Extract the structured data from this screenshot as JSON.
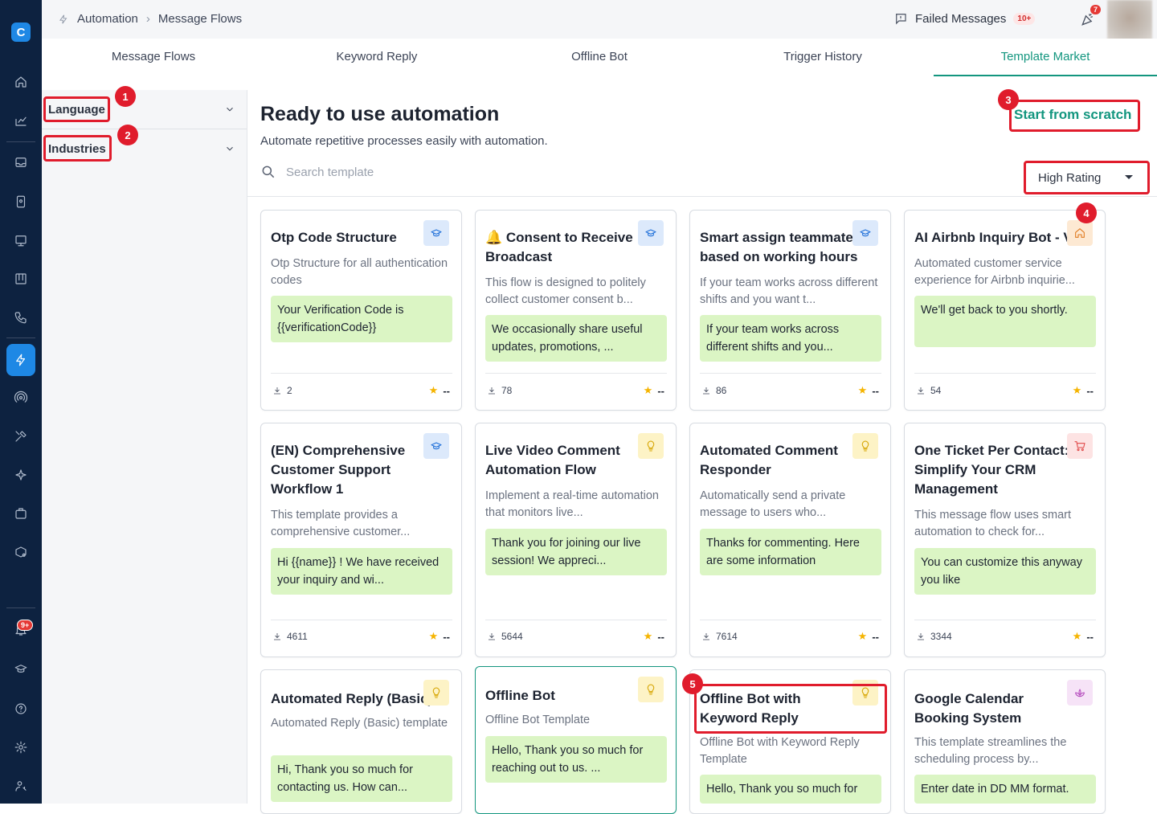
{
  "breadcrumb": {
    "section": "Automation",
    "page": "Message Flows"
  },
  "header": {
    "failed_label": "Failed Messages",
    "failed_badge": "10+",
    "notif_badge": "7"
  },
  "sidebar": {
    "logo": "C",
    "notif_badge": "9+"
  },
  "tabs": [
    "Message Flows",
    "Keyword Reply",
    "Offline Bot",
    "Trigger History",
    "Template Market"
  ],
  "active_tab": "Template Market",
  "filters": [
    {
      "label": "Language"
    },
    {
      "label": "Industries"
    }
  ],
  "main": {
    "title": "Ready to use automation",
    "subtitle": "Automate repetitive processes easily with automation.",
    "start_scratch": "Start from scratch",
    "search_placeholder": "Search template",
    "sort_value": "High Rating"
  },
  "annotations": [
    "1",
    "2",
    "3",
    "4",
    "5"
  ],
  "cards": [
    {
      "title": "Otp Code Structure",
      "desc": "Otp Structure for all authentication codes",
      "message": "Your Verification Code is {{verificationCode}}",
      "downloads": "2",
      "rating": "--",
      "icon": "graduation-cap-icon"
    },
    {
      "title": "🔔 Consent to Receive Broadcast",
      "desc": "This flow is designed to politely collect customer consent b...",
      "message": "We occasionally share useful updates, promotions, ...",
      "downloads": "78",
      "rating": "--",
      "icon": "graduation-cap-icon"
    },
    {
      "title": "Smart assign teammate based on working hours",
      "desc": "If your team works across different shifts and you want t...",
      "message": "If your team works across different shifts and you...",
      "downloads": "86",
      "rating": "--",
      "icon": "graduation-cap-icon"
    },
    {
      "title": "AI Airbnb Inquiry Bot - V",
      "desc": "Automated customer service experience for Airbnb inquirie...",
      "message": "We'll get back to you shortly.",
      "downloads": "54",
      "rating": "--",
      "icon": "home-icon"
    },
    {
      "title": "(EN) Comprehensive Customer Support Workflow 1",
      "desc": "This template provides a comprehensive customer...",
      "message": "Hi {{name}} ! We have received your inquiry and wi...",
      "downloads": "4611",
      "rating": "--",
      "icon": "graduation-cap-icon"
    },
    {
      "title": "Live Video Comment Automation Flow",
      "desc": "Implement a real-time automation that monitors live...",
      "message": "Thank you for joining our live session! We appreci...",
      "downloads": "5644",
      "rating": "--",
      "icon": "lightbulb-icon"
    },
    {
      "title": "Automated Comment Responder",
      "desc": "Automatically send a private message to users who...",
      "message": "Thanks for commenting. Here are some information",
      "downloads": "7614",
      "rating": "--",
      "icon": "lightbulb-icon"
    },
    {
      "title": "One Ticket Per Contact: Simplify Your CRM Management",
      "desc": "This message flow uses smart automation to check for...",
      "message": "You can customize this anyway you like",
      "downloads": "3344",
      "rating": "--",
      "icon": "shopping-cart-icon"
    },
    {
      "title": "Automated Reply (Basic)",
      "desc": "Automated Reply (Basic) template",
      "message": "Hi, Thank you so much for contacting us. How can...",
      "icon": "lightbulb-icon"
    },
    {
      "title": "Offline Bot",
      "desc": "Offline Bot Template",
      "message": "Hello, Thank you so much for reaching out to us. ...",
      "icon": "lightbulb-icon"
    },
    {
      "title": "Offline Bot with Keyword Reply",
      "desc": "Offline Bot with Keyword Reply Template",
      "message": "Hello, Thank you so much for",
      "icon": "lightbulb-icon"
    },
    {
      "title": "Google Calendar Booking System",
      "desc": "This template streamlines the scheduling process by...",
      "message": "Enter date in DD MM format.",
      "icon": "lotus-icon"
    }
  ]
}
